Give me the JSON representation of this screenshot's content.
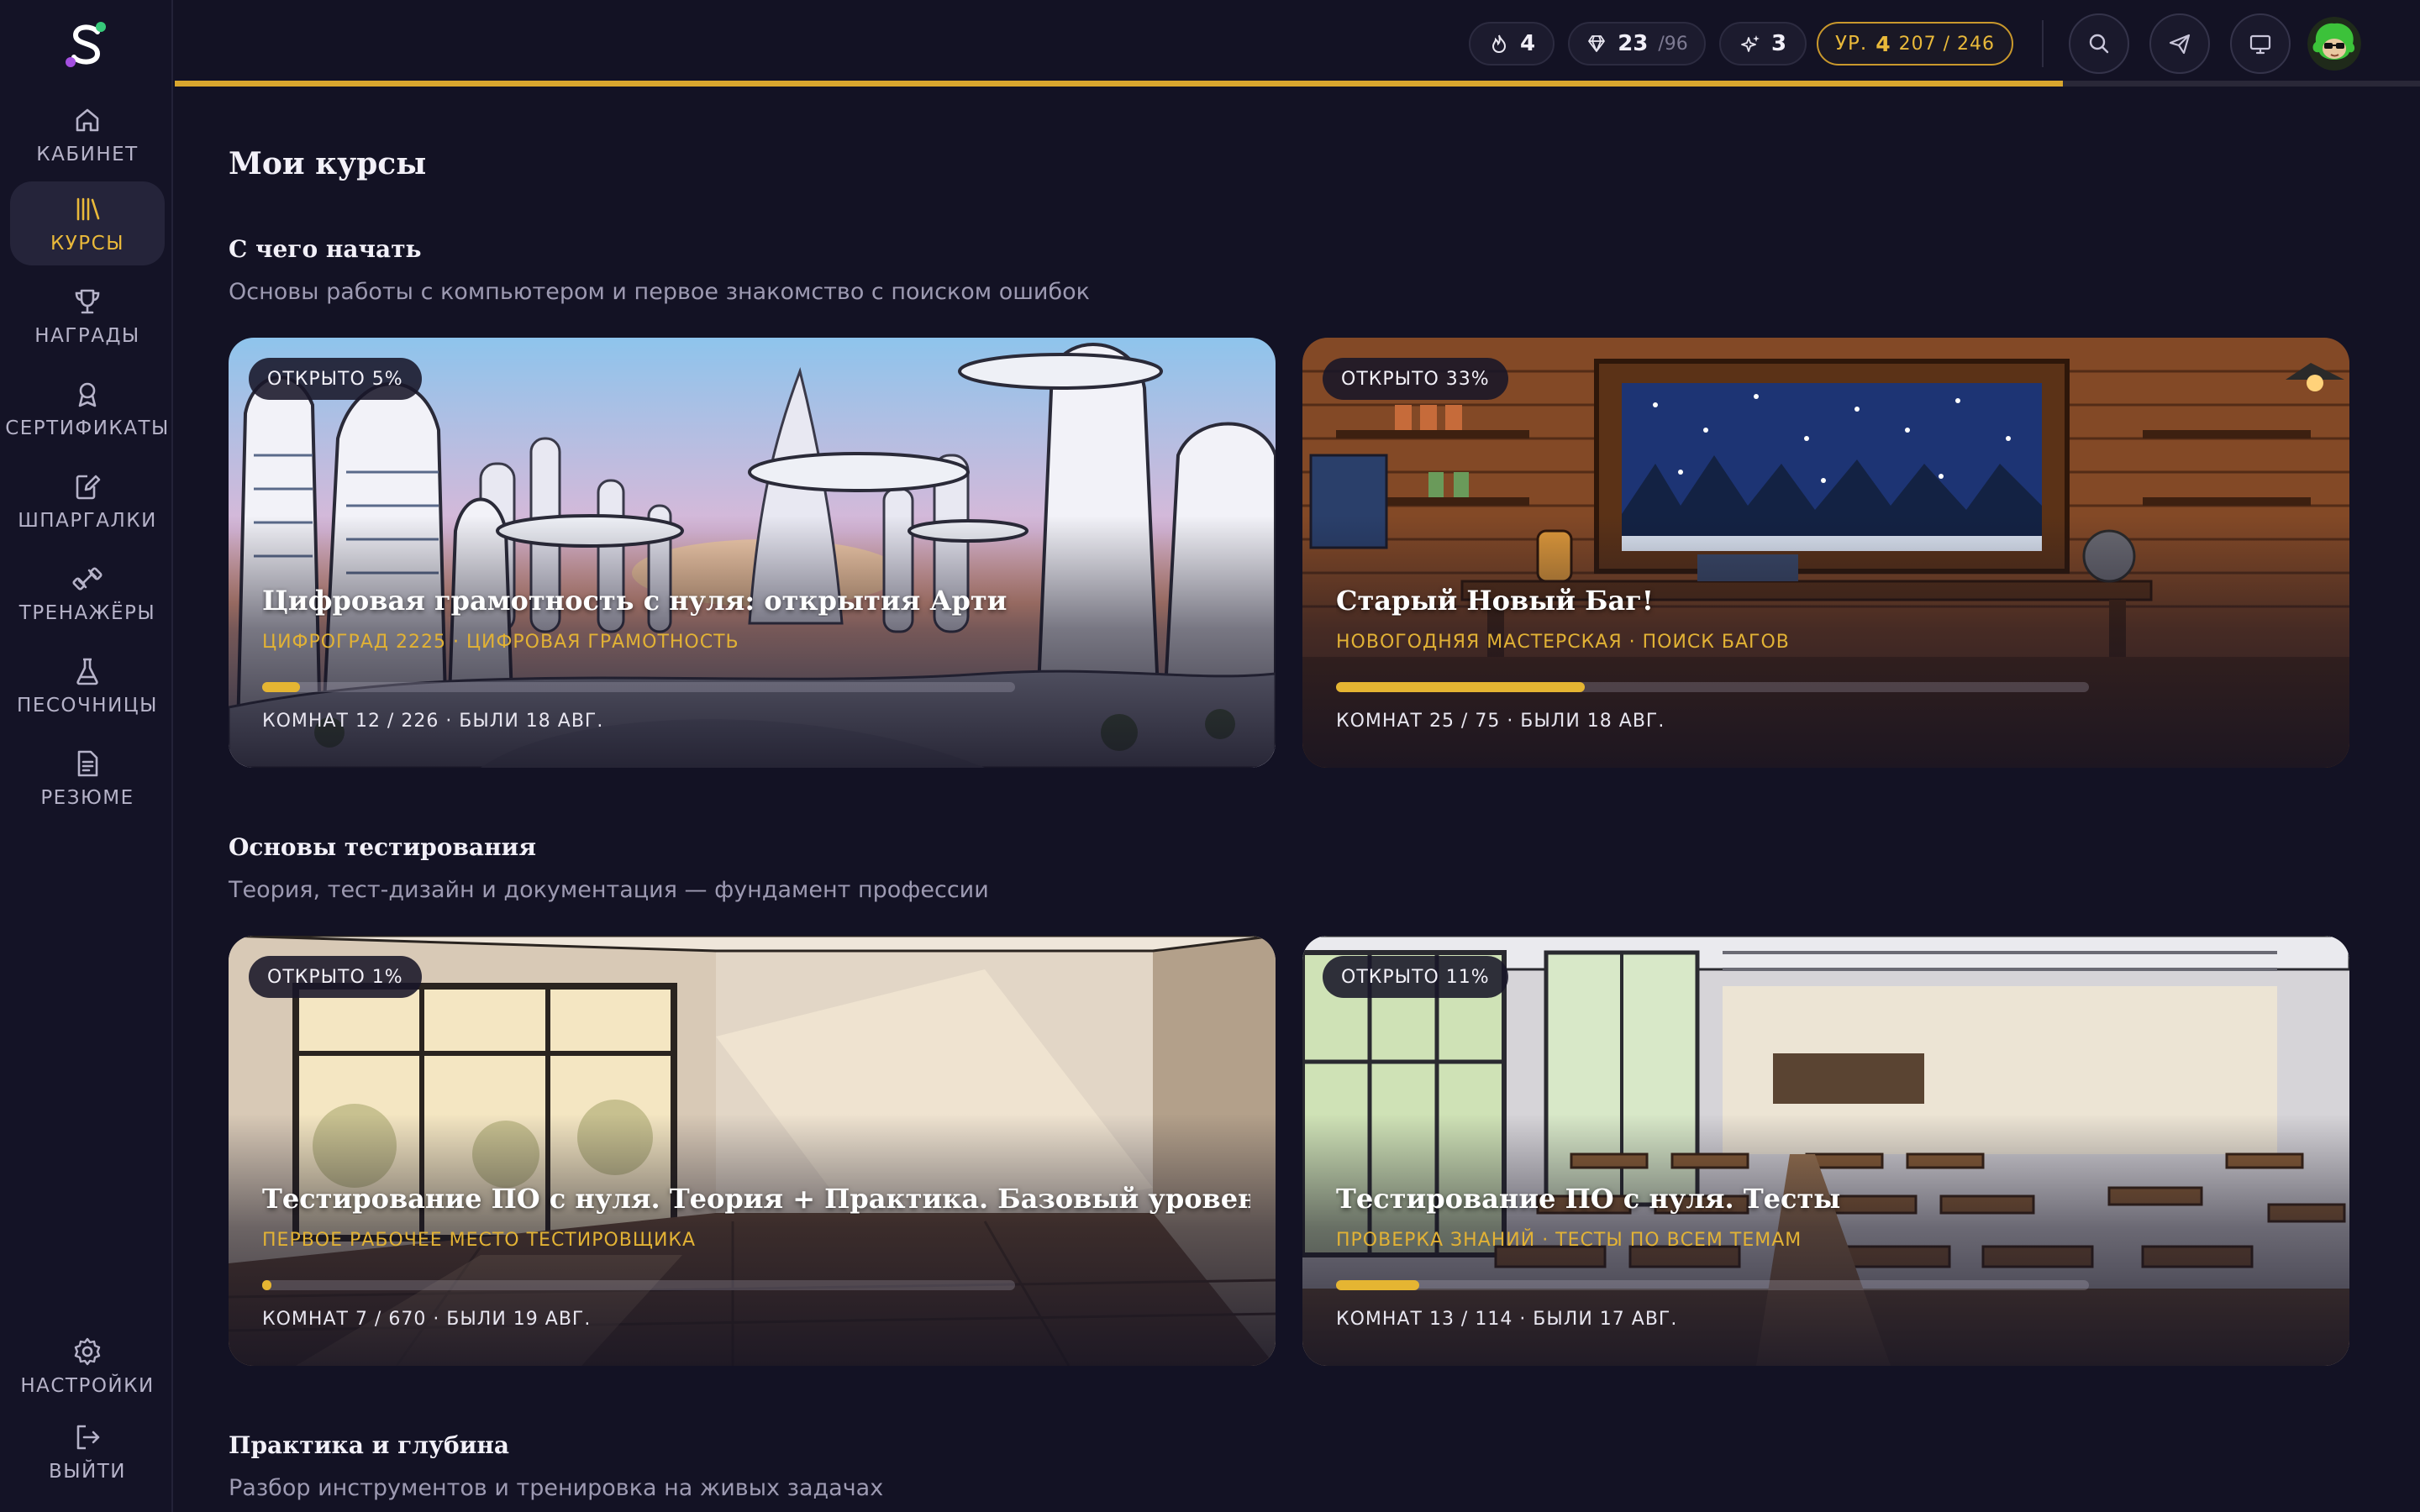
{
  "sidebar": {
    "items": [
      {
        "label": "КАБИНЕТ",
        "icon": "home-icon"
      },
      {
        "label": "КУРСЫ",
        "icon": "books-icon"
      },
      {
        "label": "НАГРАДЫ",
        "icon": "trophy-icon"
      },
      {
        "label": "СЕРТИФИКАТЫ",
        "icon": "certificate-icon"
      },
      {
        "label": "ШПАРГАЛКИ",
        "icon": "notes-icon"
      },
      {
        "label": "ТРЕНАЖЁРЫ",
        "icon": "dumbbell-icon"
      },
      {
        "label": "ПЕСОЧНИЦЫ",
        "icon": "flask-icon"
      },
      {
        "label": "РЕЗЮМЕ",
        "icon": "document-icon"
      }
    ],
    "bottom": [
      {
        "label": "НАСТРОЙКИ",
        "icon": "gear-icon"
      },
      {
        "label": "ВЫЙТИ",
        "icon": "logout-icon"
      }
    ],
    "active_index": 1
  },
  "topbar": {
    "streak": "4",
    "gems": "23",
    "gems_total": "/96",
    "boosts": "3",
    "level_prefix": "УР.",
    "level": "4",
    "level_xp": "207 / 246",
    "level_progress": 0.841
  },
  "main": {
    "title": "Мои курсы",
    "sections": [
      {
        "title": "С чего начать",
        "subtitle": "Основы работы с компьютером и первое знакомство с поиском ошибок",
        "cards": [
          {
            "badge": "ОТКРЫТО 5%",
            "title": "Цифровая грамотность с нуля: открытия Арти",
            "subtitle": "ЦИФРОГРАД 2225 · ЦИФРОВАЯ ГРАМОТНОСТЬ",
            "progress": 0.05,
            "meta": "КОМНАТ 12 / 226 · БЫЛИ 18 АВГ."
          },
          {
            "badge": "ОТКРЫТО 33%",
            "title": "Старый Новый Баг!",
            "subtitle": "НОВОГОДНЯЯ МАСТЕРСКАЯ · ПОИСК БАГОВ",
            "progress": 0.33,
            "meta": "КОМНАТ 25 / 75 · БЫЛИ 18 АВГ."
          }
        ]
      },
      {
        "title": "Основы тестирования",
        "subtitle": "Теория, тест-дизайн и документация — фундамент профессии",
        "cards": [
          {
            "badge": "ОТКРЫТО 1%",
            "title": "Тестирование ПО с нуля. Теория + Практика. Базовый уровень",
            "subtitle": "ПЕРВОЕ РАБОЧЕЕ МЕСТО ТЕСТИРОВЩИКА",
            "progress": 0.01,
            "meta": "КОМНАТ 7 / 670 · БЫЛИ 19 АВГ."
          },
          {
            "badge": "ОТКРЫТО 11%",
            "title": "Тестирование ПО с нуля. Тесты",
            "subtitle": "ПРОВЕРКА ЗНАНИЙ · ТЕСТЫ ПО ВСЕМ ТЕМАМ",
            "progress": 0.11,
            "meta": "КОМНАТ 13 / 114 · БЫЛИ 17 АВГ."
          }
        ]
      },
      {
        "title": "Практика и глубина",
        "subtitle": "Разбор инструментов и тренировка на живых задачах"
      }
    ]
  },
  "colors": {
    "background": "#131224",
    "accent": "#e5b532",
    "sidebar_active": "#25243a"
  }
}
